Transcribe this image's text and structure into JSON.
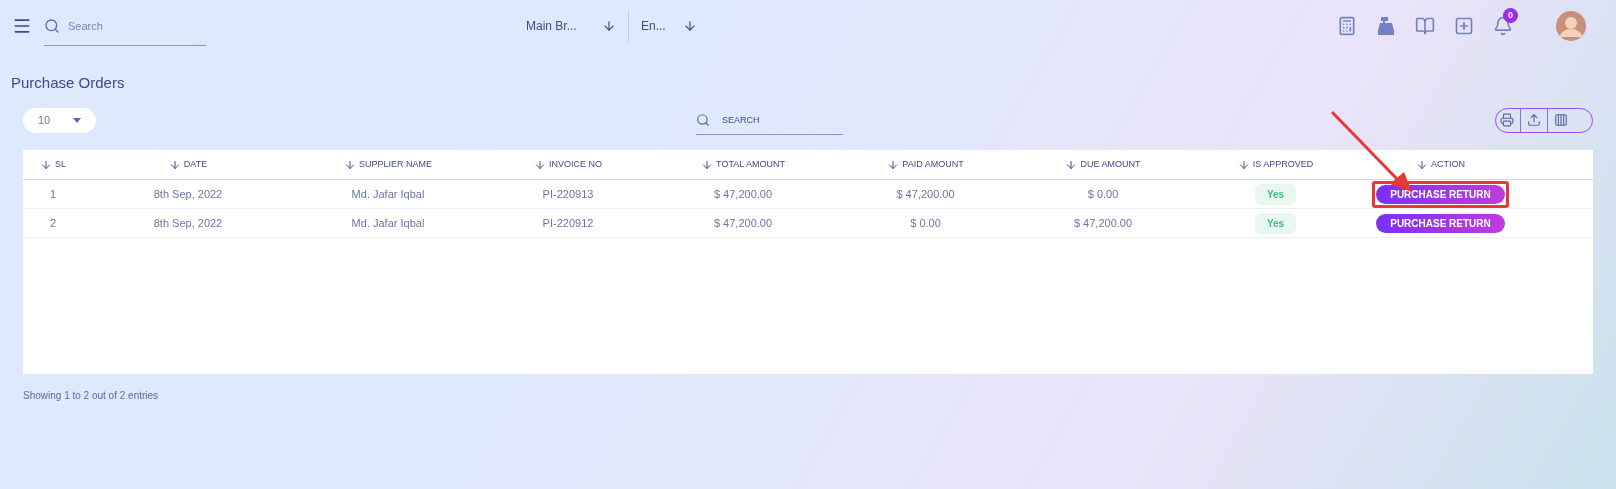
{
  "top_bar": {
    "search": {
      "placeholder": "Search"
    },
    "branch": "Main Br...",
    "language": "En...",
    "notifications": "0"
  },
  "title": "Purchase Orders",
  "toolbar": {
    "page_size": "10",
    "search": {
      "placeholder": "SEARCH"
    }
  },
  "table": {
    "columns": [
      "SL",
      "DATE",
      "SUPPLIER NAME",
      "INVOICE NO",
      "TOTAL AMOUNT",
      "PAID AMOUNT",
      "DUE AMOUNT",
      "IS APPROVED",
      "ACTION"
    ],
    "rows": [
      {
        "sl": "1",
        "date": "8th Sep, 2022",
        "supplier": "Md. Jafar Iqbal",
        "invoice": "PI-220913",
        "total": "$ 47,200.00",
        "paid": "$ 47,200.00",
        "due": "$ 0.00",
        "approved": "Yes",
        "action": "PURCHASE RETURN",
        "highlighted": true
      },
      {
        "sl": "2",
        "date": "8th Sep, 2022",
        "supplier": "Md. Jafar Iqbal",
        "invoice": "PI-220912",
        "total": "$ 47,200.00",
        "paid": "$ 0.00",
        "due": "$ 47,200.00",
        "approved": "Yes",
        "action": "PURCHASE RETURN",
        "highlighted": false
      }
    ]
  },
  "footer": "Showing 1 to 2 out of 2 entries"
}
